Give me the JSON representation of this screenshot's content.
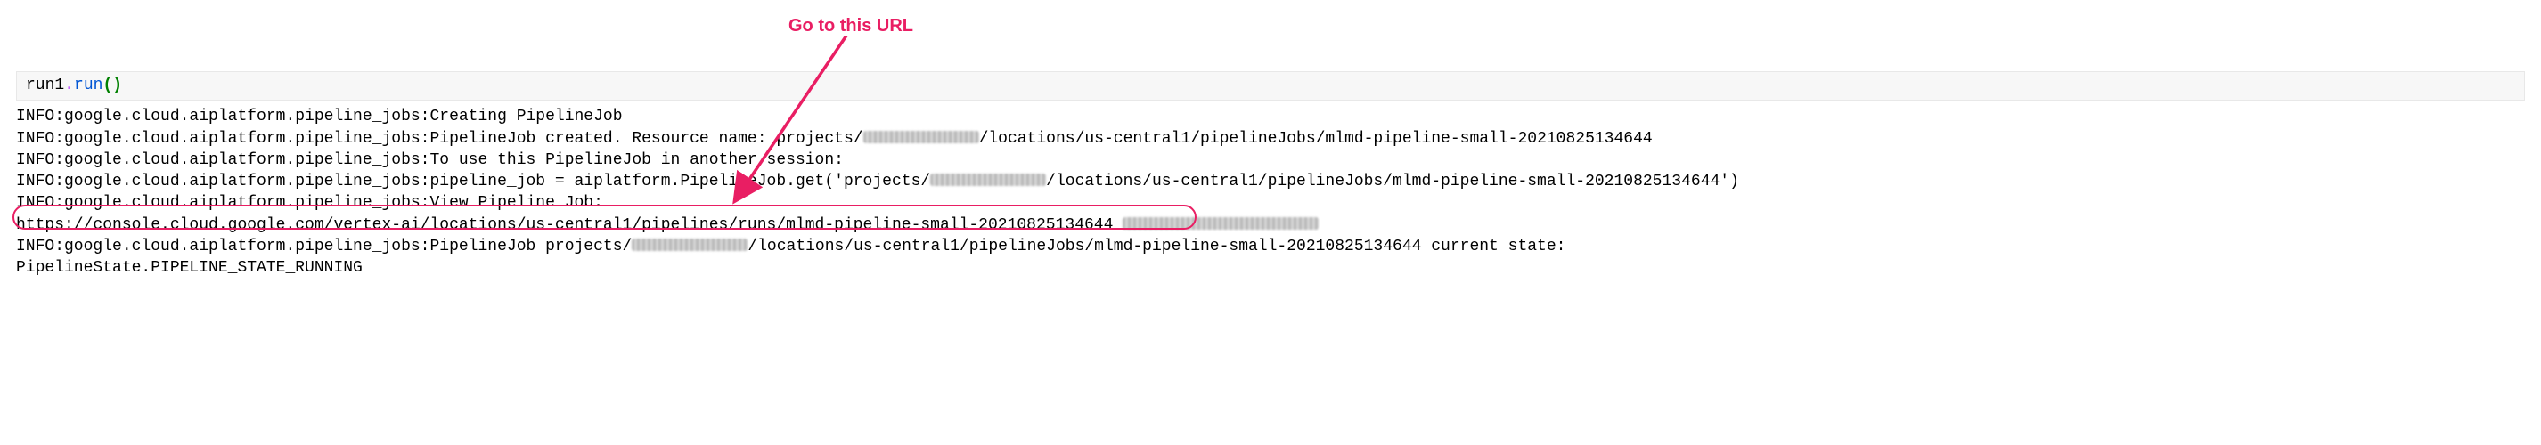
{
  "annotation": {
    "label": "Go to this URL"
  },
  "code": {
    "object": "run1",
    "operator": ".",
    "func": "run",
    "paren_open": "(",
    "paren_close": ")"
  },
  "output": {
    "l1": "INFO:google.cloud.aiplatform.pipeline_jobs:Creating PipelineJob",
    "l2_pre": "INFO:google.cloud.aiplatform.pipeline_jobs:PipelineJob created. Resource name: projects/",
    "l2_post": "/locations/us-central1/pipelineJobs/mlmd-pipeline-small-20210825134644",
    "l3": "INFO:google.cloud.aiplatform.pipeline_jobs:To use this PipelineJob in another session:",
    "l4_pre": "INFO:google.cloud.aiplatform.pipeline_jobs:pipeline_job = aiplatform.PipelineJob.get('projects/",
    "l4_post": "/locations/us-central1/pipelineJobs/mlmd-pipeline-small-20210825134644')",
    "l5": "INFO:google.cloud.aiplatform.pipeline_jobs:View Pipeline Job:",
    "url": "https://console.cloud.google.com/vertex-ai/locations/us-central1/pipelines/runs/mlmd-pipeline-small-20210825134644",
    "l7_pre": "INFO:google.cloud.aiplatform.pipeline_jobs:PipelineJob projects/",
    "l7_mid": "/locations/us-central1/pipelineJobs/mlmd-pipeline-small-20210825134644 current state:",
    "l8": "PipelineState.PIPELINE_STATE_RUNNING"
  },
  "redaction_widths": {
    "r1": 130,
    "r2": 130,
    "r3": 220,
    "r4": 130
  }
}
